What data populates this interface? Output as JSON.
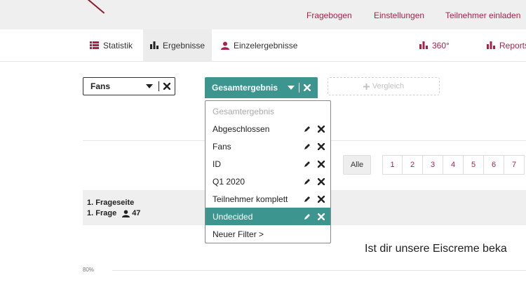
{
  "colors": {
    "accent": "#a8224a",
    "teal": "#3d9590"
  },
  "top_nav": {
    "fragebogen": "Fragebogen",
    "einstellungen": "Einstellungen",
    "teilnehmer_einladen": "Teilnehmer einladen"
  },
  "tabs": {
    "statistik": "Statistik",
    "ergebnisse": "Ergebnisse",
    "einzelergebnisse": "Einzelergebnisse",
    "n360": "360°",
    "reports": "Reports"
  },
  "filters": {
    "group_select": "Fans",
    "result_filter": "Gesamtergebnis",
    "compare": "Vergleich"
  },
  "dropdown": {
    "header": "Gesamtergebnis",
    "items": [
      "Abgeschlossen",
      "Fans",
      "ID",
      "Q1 2020",
      "Teilnehmer komplett",
      "Undecided"
    ],
    "selected": "Undecided",
    "new_filter": "Neuer Filter >"
  },
  "pager": {
    "all": "Alle",
    "pages": [
      "1",
      "2",
      "3",
      "4",
      "5",
      "6",
      "7"
    ]
  },
  "question": {
    "page": "1. Frageseite",
    "frage": "1. Frage",
    "count": "47",
    "title": "Ist dir unsere Eiscreme beka"
  },
  "chart": {
    "axis_label": "80%"
  }
}
